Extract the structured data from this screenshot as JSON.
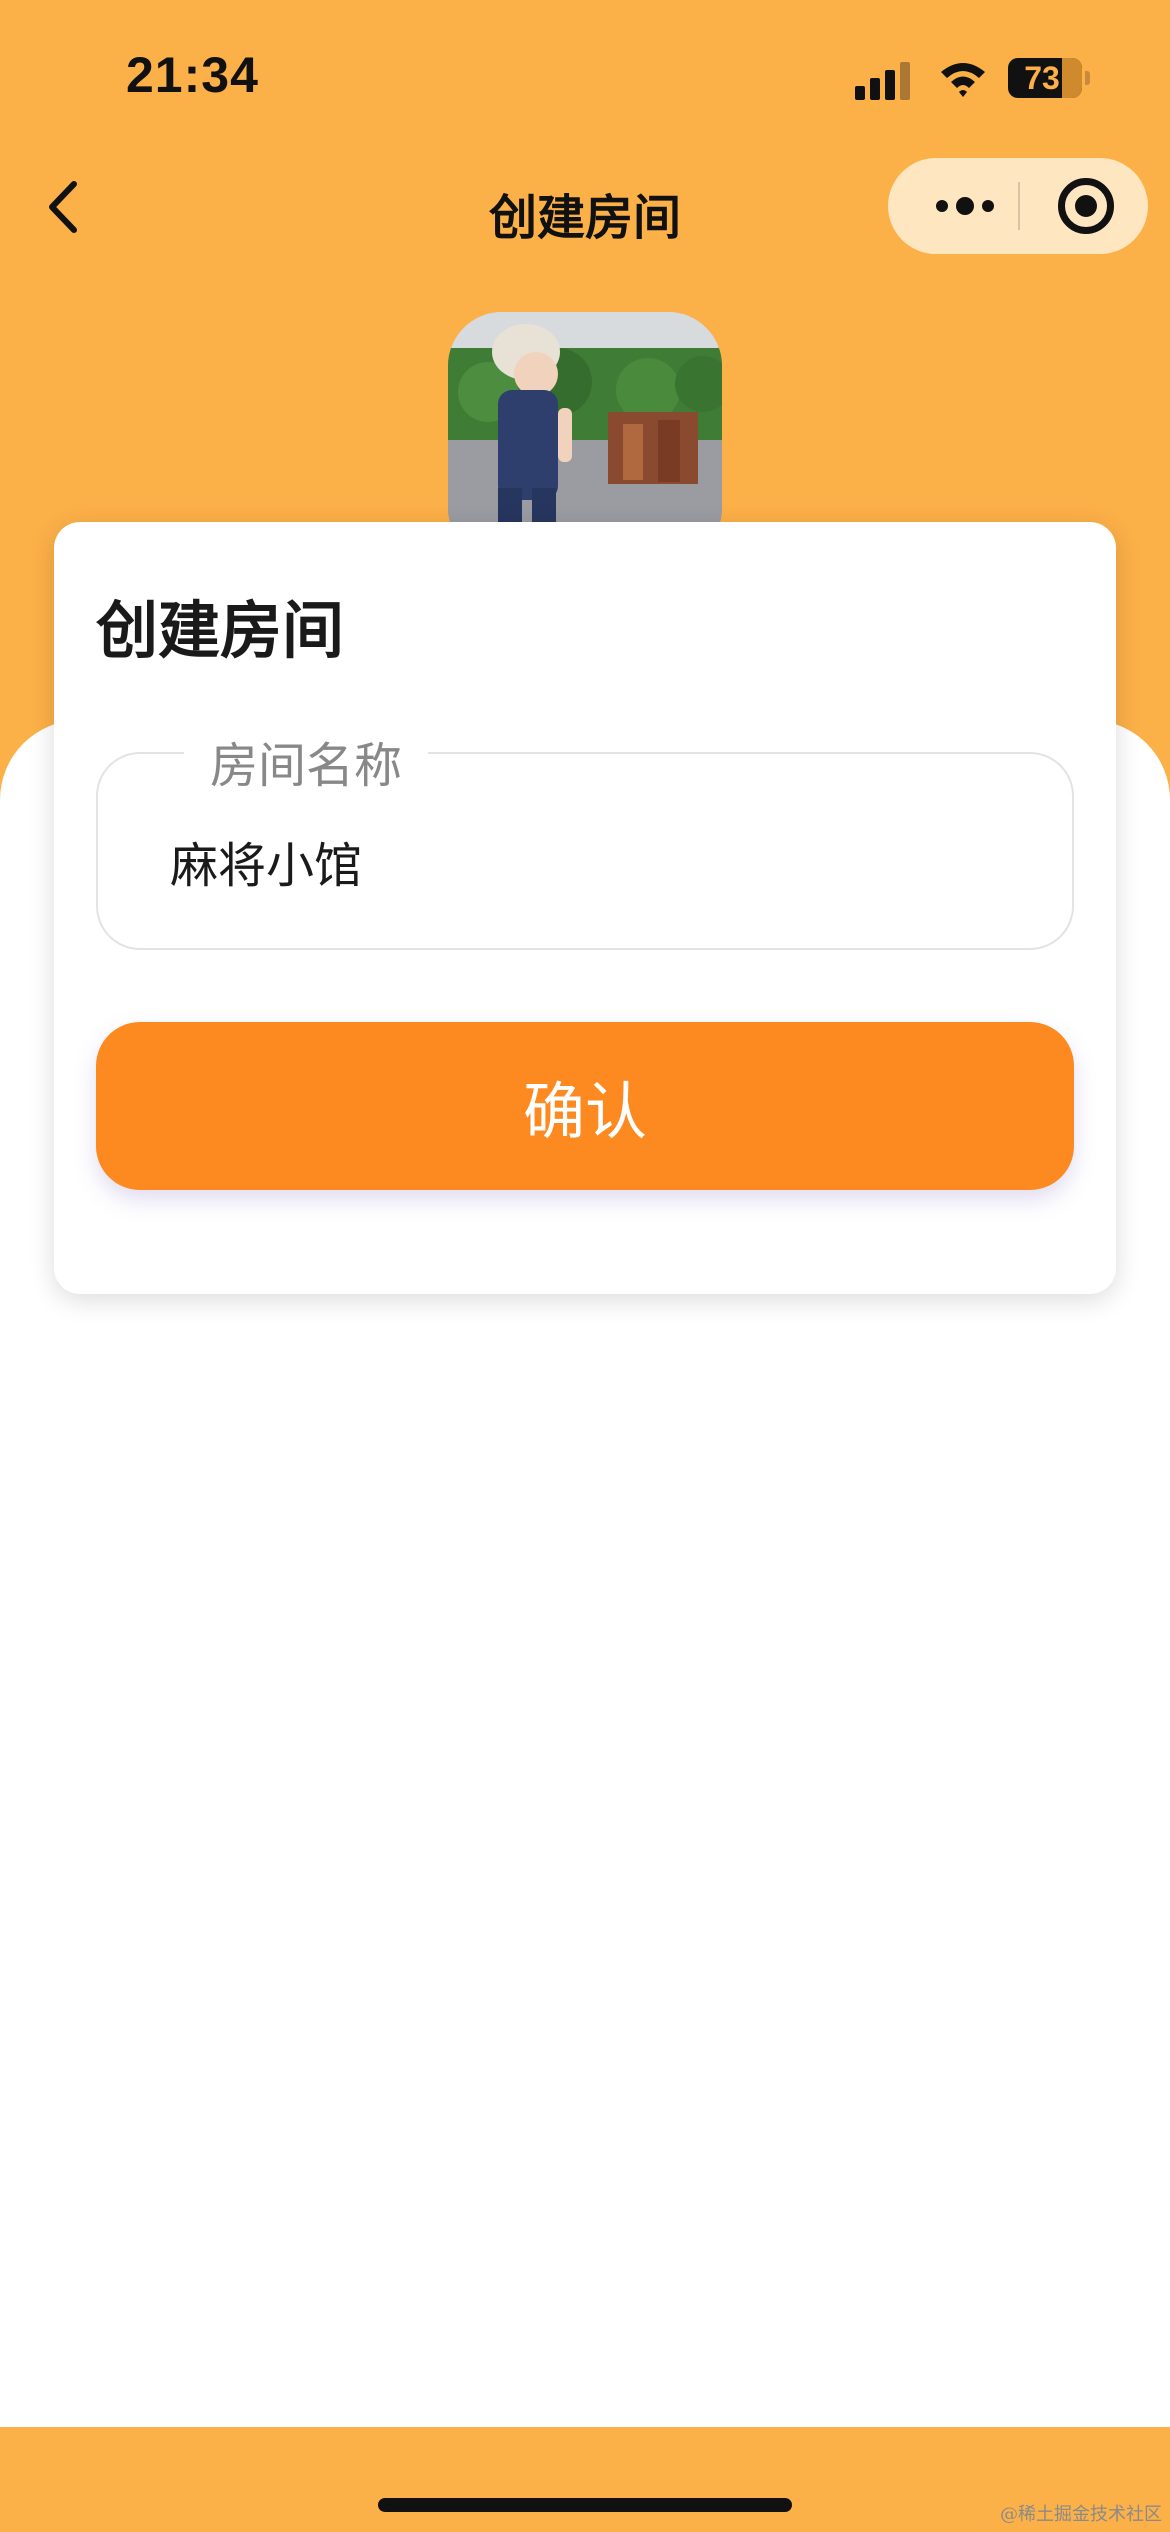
{
  "status_bar": {
    "time": "21:34",
    "battery_level": "73",
    "icons": [
      "signal-icon",
      "wifi-icon",
      "battery-icon"
    ]
  },
  "nav": {
    "title": "创建房间",
    "back_icon": "chevron-left-icon",
    "more_icon": "more-dots-icon",
    "close_icon": "target-close-icon"
  },
  "card": {
    "title": "创建房间",
    "room_name_field": {
      "label": "房间名称",
      "value": "麻将小馆"
    },
    "confirm_label": "确认"
  },
  "watermark": "@稀土掘金技术社区",
  "colors": {
    "header_bg": "#FCB048",
    "button_bg": "#FD8A21",
    "capsule_bg": "#FEE6C1",
    "text_primary": "#1A1A1A",
    "text_muted": "#888888"
  }
}
